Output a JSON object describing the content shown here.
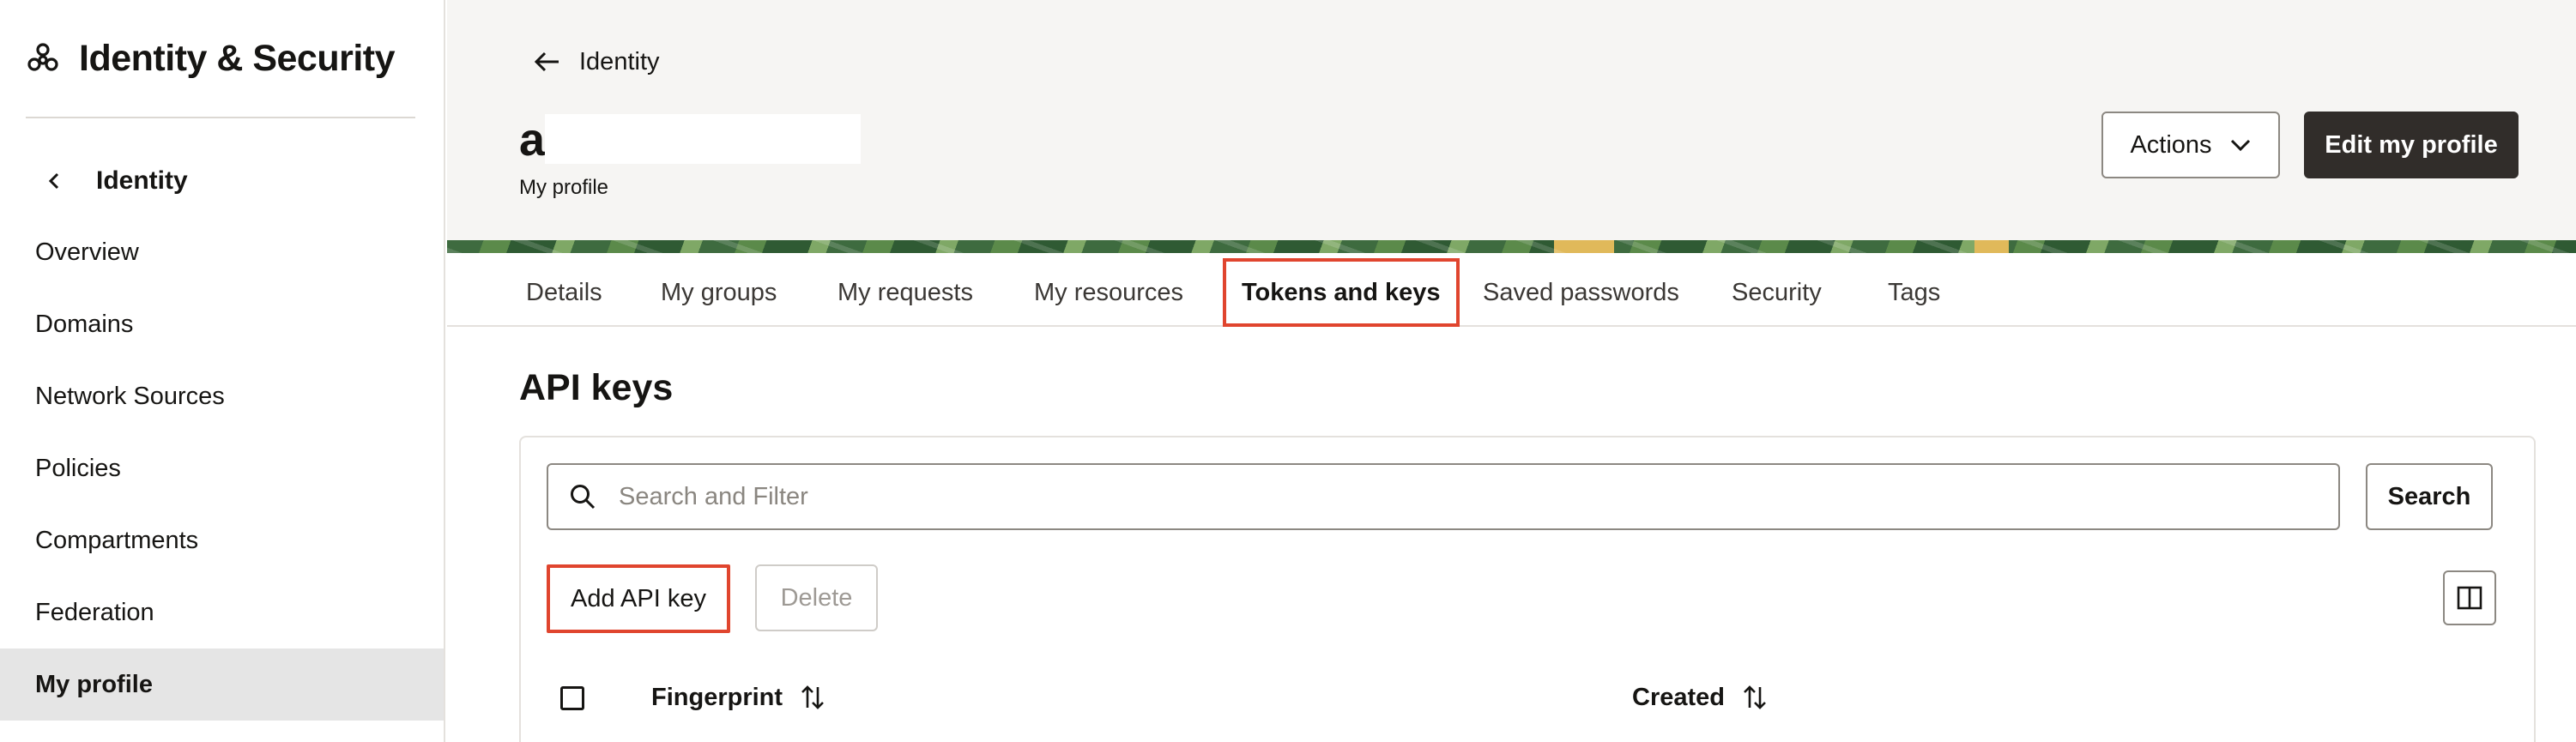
{
  "sidebar": {
    "title": "Identity & Security",
    "back_label": "Identity",
    "items": [
      {
        "label": "Overview"
      },
      {
        "label": "Domains"
      },
      {
        "label": "Network Sources"
      },
      {
        "label": "Policies"
      },
      {
        "label": "Compartments"
      },
      {
        "label": "Federation"
      },
      {
        "label": "My profile",
        "active": true
      }
    ]
  },
  "header": {
    "breadcrumb": "Identity",
    "user_initial": "a",
    "subtitle": "My profile",
    "actions_label": "Actions",
    "edit_label": "Edit my profile"
  },
  "tabs": [
    {
      "label": "Details"
    },
    {
      "label": "My groups"
    },
    {
      "label": "My requests"
    },
    {
      "label": "My resources"
    },
    {
      "label": "Tokens and keys",
      "active": true
    },
    {
      "label": "Saved passwords"
    },
    {
      "label": "Security"
    },
    {
      "label": "Tags"
    }
  ],
  "api_keys": {
    "title": "API keys",
    "search_placeholder": "Search and Filter",
    "search_button": "Search",
    "add_button": "Add API key",
    "delete_button": "Delete",
    "columns": [
      {
        "label": "Fingerprint"
      },
      {
        "label": "Created"
      }
    ]
  },
  "colors": {
    "highlight": "#e0452e",
    "primary_button": "#312d2a",
    "active_nav_bg": "#e5e5e5"
  }
}
